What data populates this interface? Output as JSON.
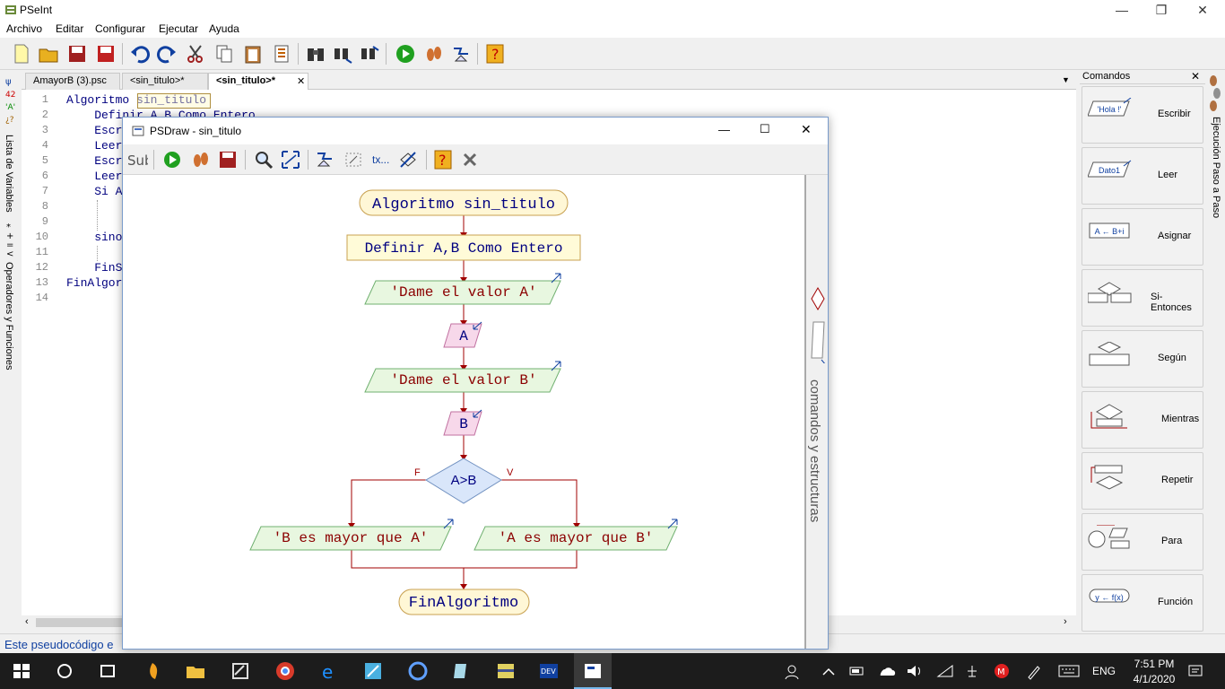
{
  "window": {
    "title": "PSeInt"
  },
  "menu": [
    "Archivo",
    "Editar",
    "Configurar",
    "Ejecutar",
    "Ayuda"
  ],
  "left_strip": {
    "variables_label": "Lista de Variables",
    "operators_label": "Operadores y Funciones"
  },
  "tabs": [
    {
      "label": "AmayorB (3).psc"
    },
    {
      "label": "<sin_titulo>*"
    },
    {
      "label": "<sin_titulo>*"
    }
  ],
  "editor": {
    "lines": [
      {
        "n": "1",
        "text": "Algoritmo sin_titulo"
      },
      {
        "n": "2",
        "text": "    Definir A,B Como Entero"
      },
      {
        "n": "3",
        "text": "    Escr"
      },
      {
        "n": "4",
        "text": "    Leer"
      },
      {
        "n": "5",
        "text": "    Escr"
      },
      {
        "n": "6",
        "text": "    Leer"
      },
      {
        "n": "7",
        "text": "    Si A"
      },
      {
        "n": "8",
        "text": ""
      },
      {
        "n": "9",
        "text": ""
      },
      {
        "n": "10",
        "text": "    sino"
      },
      {
        "n": "11",
        "text": ""
      },
      {
        "n": "12",
        "text": "    FinS"
      },
      {
        "n": "13",
        "text": "FinAlgor"
      },
      {
        "n": "14",
        "text": ""
      }
    ]
  },
  "status": {
    "text": "Este pseudocódigo e"
  },
  "commands_panel": {
    "title": "Comandos",
    "items": [
      {
        "label": "Escribir",
        "icon_text": "'Hola !'"
      },
      {
        "label": "Leer",
        "icon_text": "Dato1"
      },
      {
        "label": "Asignar",
        "icon_text": "A ← B+i"
      },
      {
        "label": "Si-Entonces",
        "icon_text": ""
      },
      {
        "label": "Según",
        "icon_text": ""
      },
      {
        "label": "Mientras",
        "icon_text": ""
      },
      {
        "label": "Repetir",
        "icon_text": ""
      },
      {
        "label": "Para",
        "icon_text": ""
      },
      {
        "label": "Función",
        "icon_text": "y ← f(x)"
      }
    ]
  },
  "right_strip": {
    "label": "Ejecución Paso a Paso"
  },
  "psdraw": {
    "title": "PSDraw - sin_titulo",
    "side_label": "comandos y estructuras",
    "toolbar_text": "tx...",
    "flow": {
      "start": "Algoritmo sin_titulo",
      "define": "Definir A,B Como Entero",
      "write1": "'Dame el valor A'",
      "read1": "A",
      "write2": "'Dame el valor B'",
      "read2": "B",
      "cond": "A>B",
      "false_label": "F",
      "true_label": "V",
      "false_out": "'B es mayor que A'",
      "true_out": "'A es mayor que B'",
      "end": "FinAlgoritmo"
    }
  },
  "taskbar": {
    "language": "ENG",
    "time": "7:51 PM",
    "date": "4/1/2020"
  },
  "colors": {
    "flow_stroke": "#a00000",
    "start_fill": "#fff7d6",
    "write_fill": "#e8f7e0",
    "read_fill": "#f7d8ea",
    "cond_fill": "#d9e6fa"
  }
}
